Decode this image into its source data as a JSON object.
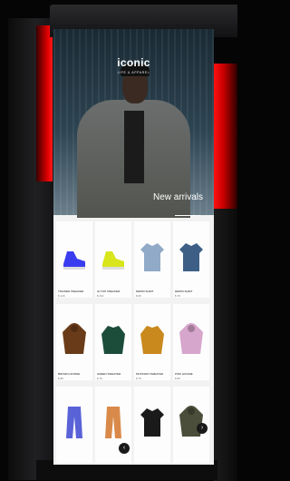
{
  "hero": {
    "brand": "iconic",
    "tagline": "LIFE & APPAREL",
    "headline": "New arrivals"
  },
  "products": [
    {
      "title": "TRAINER SNEAKER",
      "price": "$ 129",
      "icon": "blue-sneaker-icon",
      "color": "#3a3cf0"
    },
    {
      "title": "HI-TOP SNEAKER",
      "price": "$ 119",
      "icon": "lime-sneaker-icon",
      "color": "#d7e51a"
    },
    {
      "title": "DENIM SHIRT",
      "price": "$ 69",
      "icon": "light-denim-shirt-icon",
      "color": "#90aac7"
    },
    {
      "title": "DENIM SHIRT",
      "price": "$ 79",
      "icon": "dark-denim-shirt-icon",
      "color": "#3d5f86"
    },
    {
      "title": "BROWN HOODIE",
      "price": "$ 89",
      "icon": "brown-hoodie-icon",
      "color": "#6a3b18"
    },
    {
      "title": "GREEN SWEATER",
      "price": "$ 79",
      "icon": "green-sweater-icon",
      "color": "#1b4d3a"
    },
    {
      "title": "MUSTARD SWEATER",
      "price": "$ 79",
      "icon": "mustard-sweater-icon",
      "color": "#c9891c"
    },
    {
      "title": "PINK HOODIE",
      "price": "$ 89",
      "icon": "pink-hoodie-icon",
      "color": "#d7a6cc"
    },
    {
      "title": "",
      "price": "",
      "icon": "blue-pants-icon",
      "color": "#5a62d8"
    },
    {
      "title": "",
      "price": "",
      "icon": "orange-pants-icon",
      "color": "#d98a4a"
    },
    {
      "title": "",
      "price": "",
      "icon": "black-tee-icon",
      "color": "#1a1a1a"
    },
    {
      "title": "",
      "price": "",
      "icon": "olive-hoodie-icon",
      "color": "#4a4e3a"
    }
  ],
  "nav": {
    "prev": "‹",
    "next": "›"
  },
  "colors": {
    "accent": "#e00000"
  }
}
